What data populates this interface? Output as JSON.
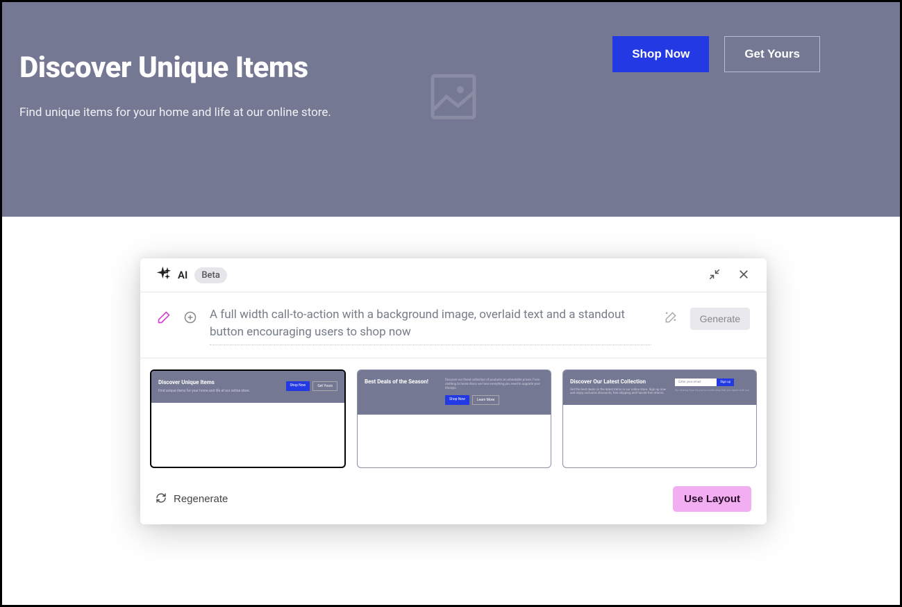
{
  "hero": {
    "title": "Discover Unique Items",
    "subtitle": "Find unique items for your home and life at our online store.",
    "primary_button": "Shop Now",
    "secondary_button": "Get Yours"
  },
  "ai_panel": {
    "label": "AI",
    "badge": "Beta",
    "prompt": "A full width call-to-action with a background image, overlaid text and a standout button encouraging users to shop now",
    "generate_label": "Generate",
    "regenerate_label": "Regenerate",
    "use_layout_label": "Use Layout",
    "layouts": [
      {
        "title": "Discover Unique Items",
        "subtitle": "Find unique items for your home and life at our online store.",
        "btn_primary": "Shop Now",
        "btn_secondary": "Get Yours"
      },
      {
        "title": "Best Deals of the Season!",
        "subtitle": "Discover our finest collection of products at unbeatable prices. From clothing to home decor we have everything you need to upgrade your lifestyle.",
        "btn_primary": "Shop Now",
        "btn_secondary": "Learn More"
      },
      {
        "title": "Discover Our Latest Collection",
        "subtitle": "Get the best deals on the latest items in our online store. Sign up now and enjoy exclusive discounts, free shipping and hassle-free returns.",
        "input_placeholder": "Enter your email",
        "submit_label": "Sign up",
        "note": "By clicking Sign Up you're confirming that you agree with our"
      }
    ]
  }
}
